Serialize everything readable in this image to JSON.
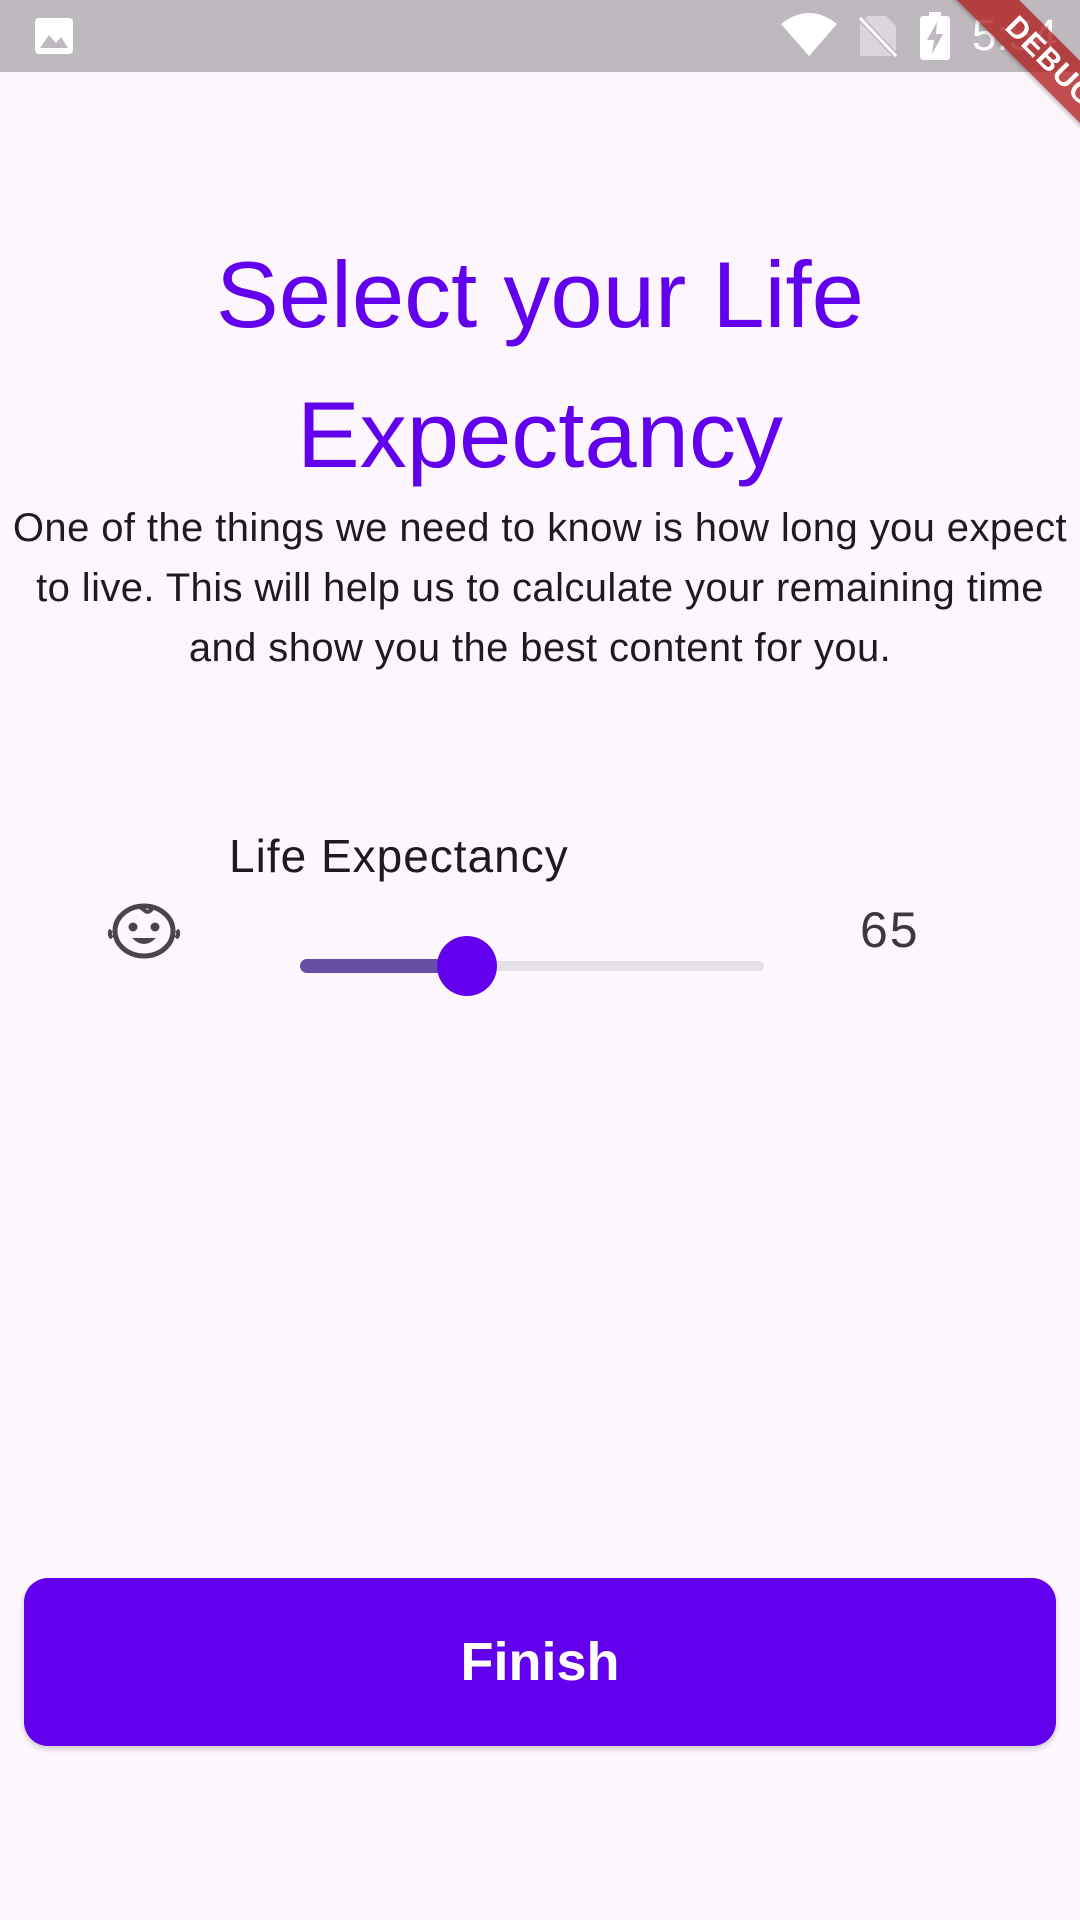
{
  "status_bar": {
    "time": "5:54",
    "icons": [
      "gallery-icon",
      "wifi-icon",
      "no-sim-icon",
      "battery-charging-icon"
    ],
    "background": "#bdb9bf"
  },
  "debug_banner": {
    "label": "DEBUG"
  },
  "header": {
    "title": "Select your Life Expectancy",
    "description": "One of the things we need to know is how long you expect to live. This will help us to calculate your remaining time and show you the best content for you."
  },
  "life_expectancy": {
    "label": "Life Expectancy",
    "icon": "baby-face-icon",
    "value": "65",
    "slider_fraction": 0.36
  },
  "actions": {
    "finish_label": "Finish"
  },
  "colors": {
    "primary": "#6200ee",
    "slider_active": "#6750a4",
    "slider_inactive": "#e6e0e9",
    "background": "#fdf7fd",
    "text": "#1d1b20"
  }
}
